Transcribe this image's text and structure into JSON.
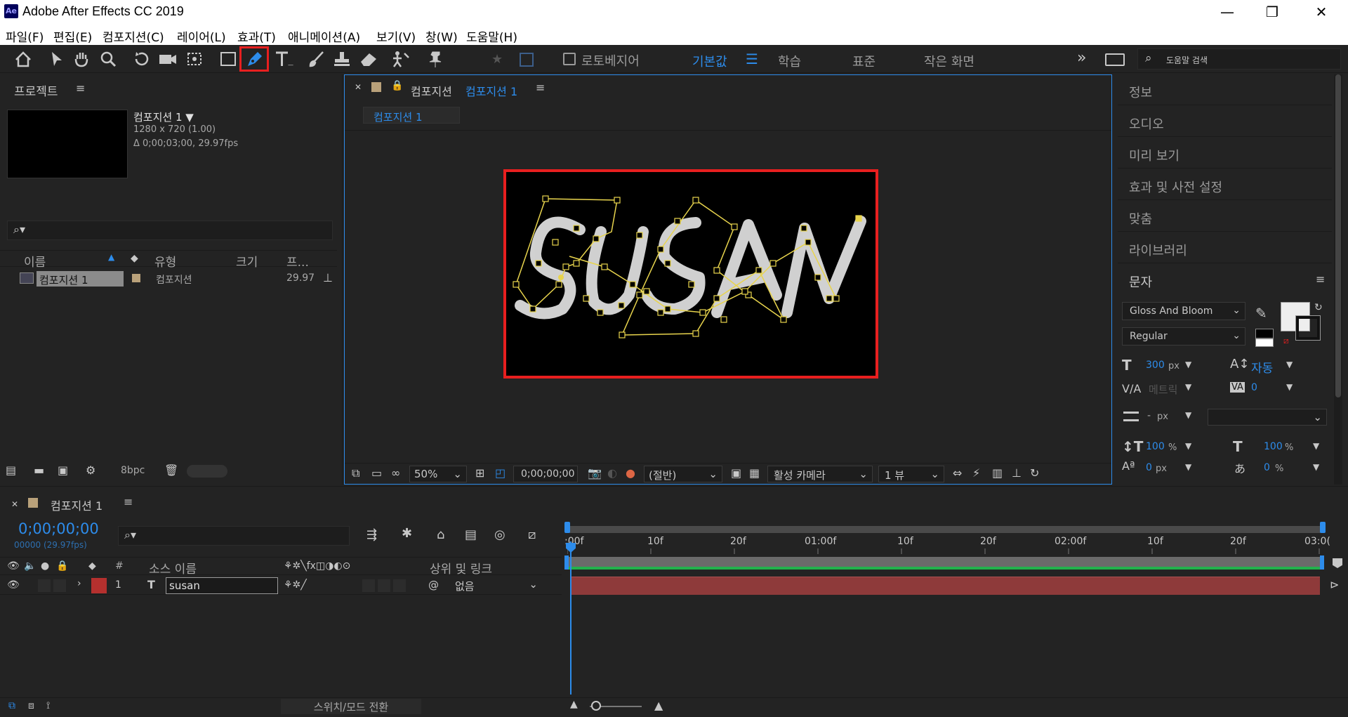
{
  "window": {
    "app_badge": "Ae",
    "title": "Adobe After Effects CC 2019",
    "minimize": "—",
    "maximize": "❐",
    "close": "✕"
  },
  "menu": [
    "파일(F)",
    "편집(E)",
    "컴포지션(C)",
    "레이어(L)",
    "효과(T)",
    "애니메이션(A)",
    "보기(V)",
    "창(W)",
    "도움말(H)"
  ],
  "toolbar": {
    "tools": [
      "home-icon",
      "selection-icon",
      "hand-icon",
      "zoom-icon",
      "rotate-icon",
      "camera-icon",
      "pan-behind-icon",
      "rectangle-icon",
      "pen-icon",
      "type-icon",
      "brush-icon",
      "clone-stamp-icon",
      "eraser-icon",
      "roto-brush-icon",
      "puppet-pin-icon"
    ],
    "active_tool": "pen-icon",
    "rotobezier_label": "로토베지어",
    "workspaces": [
      "기본값",
      "학습",
      "표준",
      "작은 화면"
    ],
    "active_workspace": "기본값",
    "search_placeholder": "도움말 검색"
  },
  "project": {
    "title": "프로젝트",
    "comp_name": "컴포지션 1 ▼",
    "comp_size": "1280 x 720 (1.00)",
    "comp_duration": "Δ 0;00;03;00, 29.97fps",
    "search_placeholder": "",
    "columns": [
      "이름",
      "유형",
      "크기",
      "프..."
    ],
    "items": [
      {
        "name": "컴포지션 1",
        "type": "컴포지션",
        "fps": "29.97"
      }
    ],
    "bpc": "8bpc"
  },
  "composition": {
    "tab_title": "컴포지션",
    "tab_name": "컴포지션 1",
    "flow_tab": "컴포지션 1",
    "zoom": "50%",
    "timecode": "0;00;00;00",
    "resolution": "(절반)",
    "camera": "활성 카메라",
    "views": "1 뷰",
    "text": "SUSAN"
  },
  "right_panels": [
    "정보",
    "오디오",
    "미리 보기",
    "효과 및 사전 설정",
    "맞춤",
    "라이브러리"
  ],
  "character": {
    "title": "문자",
    "font": "Gloss And Bloom",
    "style": "Regular",
    "font_size": "300",
    "font_size_unit": "px",
    "leading": "자동",
    "kerning": "메트릭",
    "tracking": "0",
    "stroke_width": "-",
    "stroke_unit": "px",
    "vertical_scale": "100",
    "horizontal_scale": "100",
    "baseline_shift": "0",
    "baseline_unit": "px",
    "tsume": "0",
    "percent": "%"
  },
  "timeline": {
    "comp_name": "컴포지션 1",
    "timecode": "0;00;00;00",
    "frame_info": "00000 (29.97fps)",
    "search_placeholder": "",
    "columns": {
      "num": "#",
      "source": "소스 이름",
      "parent": "상위 및 링크"
    },
    "layers": [
      {
        "num": "1",
        "name": "susan",
        "parent": "없음",
        "color": "#b5302e"
      }
    ],
    "ruler": [
      ":00f",
      "10f",
      "20f",
      "01:00f",
      "10f",
      "20f",
      "02:00f",
      "10f",
      "20f",
      "03:0("
    ],
    "toggle_mode": "스위치/모드 전환"
  },
  "colors": {
    "accent": "#2d8ceb",
    "highlight": "#e81f1f",
    "path": "#e8d44d",
    "layer_bar": "#8e3a3a",
    "work_area": "#22b14c"
  }
}
